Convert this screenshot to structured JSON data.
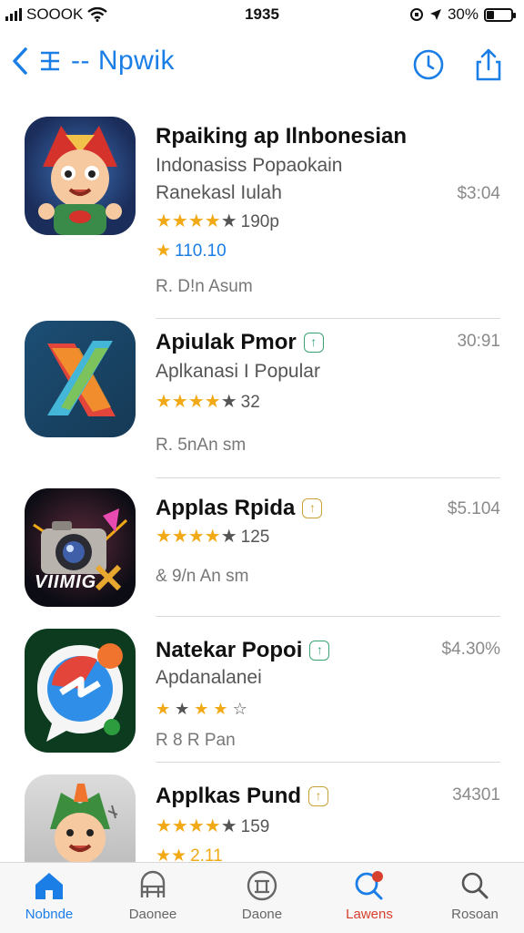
{
  "status_bar": {
    "carrier": "SOOOK",
    "time": "1935",
    "battery": "30%",
    "battery_level": 0.3
  },
  "nav": {
    "title": "-- Npwik"
  },
  "apps": [
    {
      "name": "Rpaiking ap Ilnbonesian",
      "subtitle": "Indonasiss Popaokain",
      "subtitle2": "Ranekasl Iulah",
      "price": "$3:04",
      "rating": 4,
      "rating_count": "190p",
      "rank": "110.10",
      "meta": "R. D!n Asum"
    },
    {
      "name": "Apiulak Pmor",
      "subtitle": "Aplkanasi I Popular",
      "price": "30:91",
      "rating": 4,
      "rating_count": "32",
      "meta": "R. 5nAn sm"
    },
    {
      "name": "Applas Rpida",
      "price": "$5.104",
      "rating": 4,
      "rating_count": "125",
      "meta": "& 9/n An sm",
      "icon_text": "VIIMIG"
    },
    {
      "name": "Natekar Popoi",
      "subtitle": "Apdanalanei",
      "price": "$4.30%",
      "rating": 4,
      "rating_count": "",
      "meta": "R 8 R Pan"
    },
    {
      "name": "Applkas Pund",
      "price": "34301",
      "rating": 4,
      "rating_count": "159",
      "rank": "2.11"
    }
  ],
  "tabs": [
    {
      "label": "Nobnde",
      "icon": "home-icon"
    },
    {
      "label": "Daonee",
      "icon": "apps-icon"
    },
    {
      "label": "Daone",
      "icon": "games-icon"
    },
    {
      "label": "Lawens",
      "icon": "updates-icon"
    },
    {
      "label": "Rosoan",
      "icon": "search-icon"
    }
  ],
  "colors": {
    "accent": "#1a7ee6",
    "star": "#f2a916",
    "alert": "#d8402e"
  }
}
